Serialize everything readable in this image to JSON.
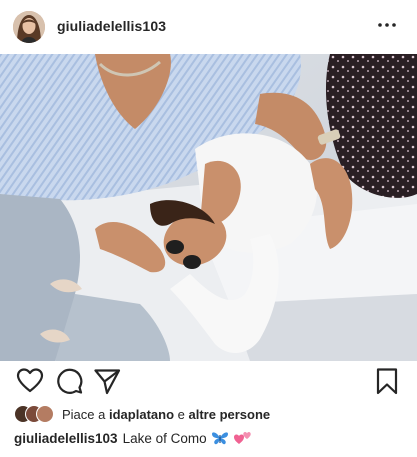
{
  "post": {
    "username": "giuliadelellis103",
    "more_icon": "more-horizontal-icon",
    "image_icon": "photo"
  },
  "actions": {
    "like_icon": "heart-icon",
    "comment_icon": "comment-icon",
    "share_icon": "send-icon",
    "save_icon": "bookmark-icon"
  },
  "likes": {
    "prefix": "Piace a",
    "liker": "idaplatano",
    "connector": "e",
    "others": "altre persone"
  },
  "caption": {
    "username": "giuliadelellis103",
    "text": "Lake of Como",
    "emojis": [
      "butterfly-emoji",
      "two-hearts-emoji"
    ]
  },
  "colors": {
    "text": "#262626",
    "butterfly": "#3b8fe0",
    "hearts": "#f06292"
  }
}
